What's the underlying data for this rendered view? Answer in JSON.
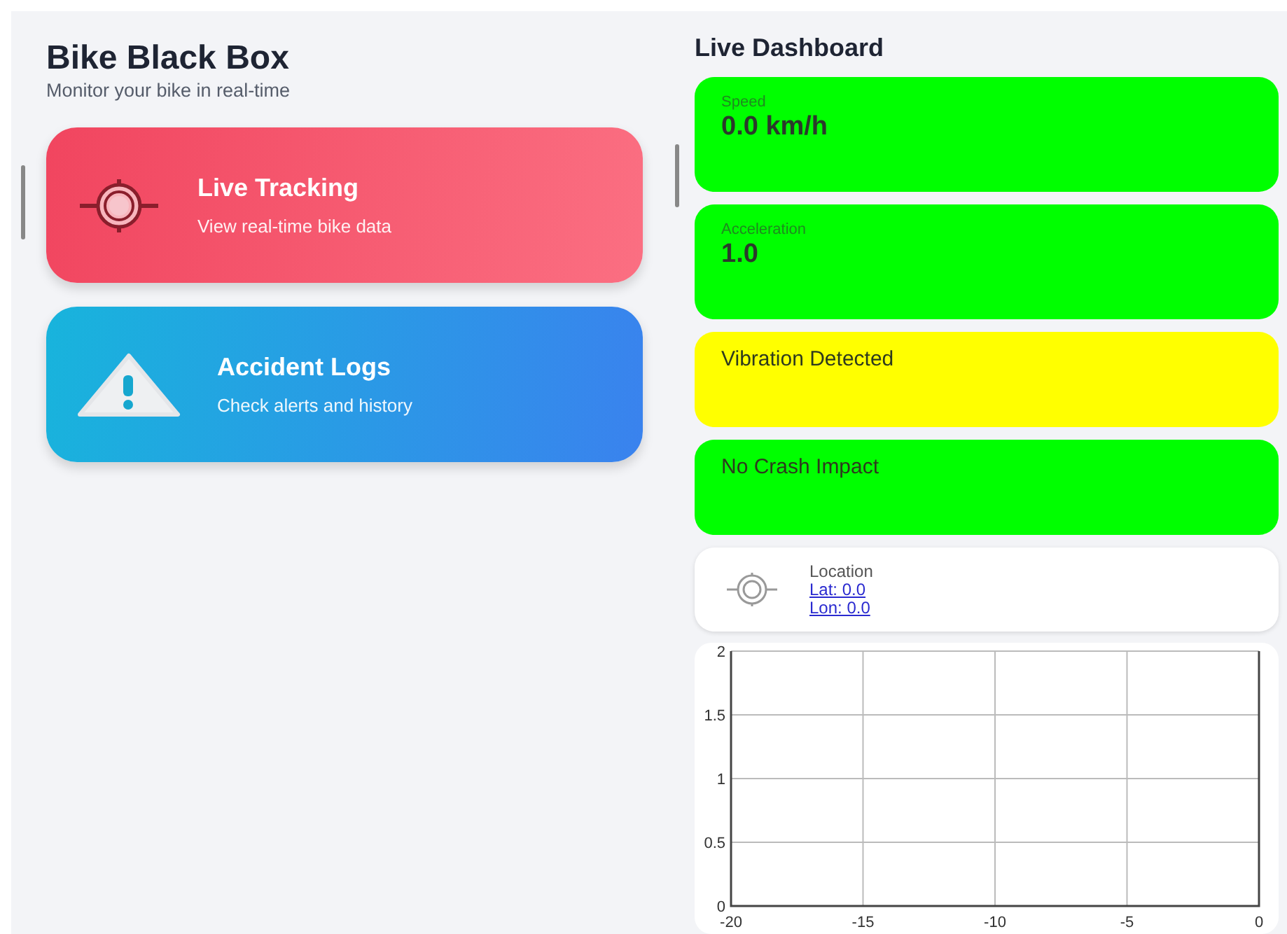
{
  "app": {
    "title": "Bike Black Box",
    "subtitle": "Monitor your bike in real-time"
  },
  "menu": [
    {
      "kind": "tracking",
      "title": "Live Tracking",
      "subtitle": "View real-time bike data"
    },
    {
      "kind": "logs",
      "title": "Accident Logs",
      "subtitle": "Check alerts and history"
    }
  ],
  "dashboard": {
    "title": "Live Dashboard",
    "cards": [
      {
        "kind": "metric",
        "label": "Speed",
        "value": "0.0 km/h",
        "color": "#00ff00"
      },
      {
        "kind": "metric",
        "label": "Acceleration",
        "value": "1.0",
        "color": "#00ff00"
      },
      {
        "kind": "status",
        "text": "Vibration Detected",
        "color": "#ffff00"
      },
      {
        "kind": "status",
        "text": "No Crash Impact",
        "color": "#00ff00"
      }
    ],
    "location": {
      "label": "Location",
      "lat": "Lat: 0.0",
      "lon": "Lon: 0.0"
    },
    "chart_data": {
      "type": "line",
      "xlim": [
        -20,
        0
      ],
      "ylim": [
        0,
        2
      ],
      "xticks": [
        -20,
        -15,
        -10,
        -5,
        0
      ],
      "yticks": [
        0,
        0.5,
        1,
        1.5,
        2
      ],
      "grid": true
    }
  }
}
